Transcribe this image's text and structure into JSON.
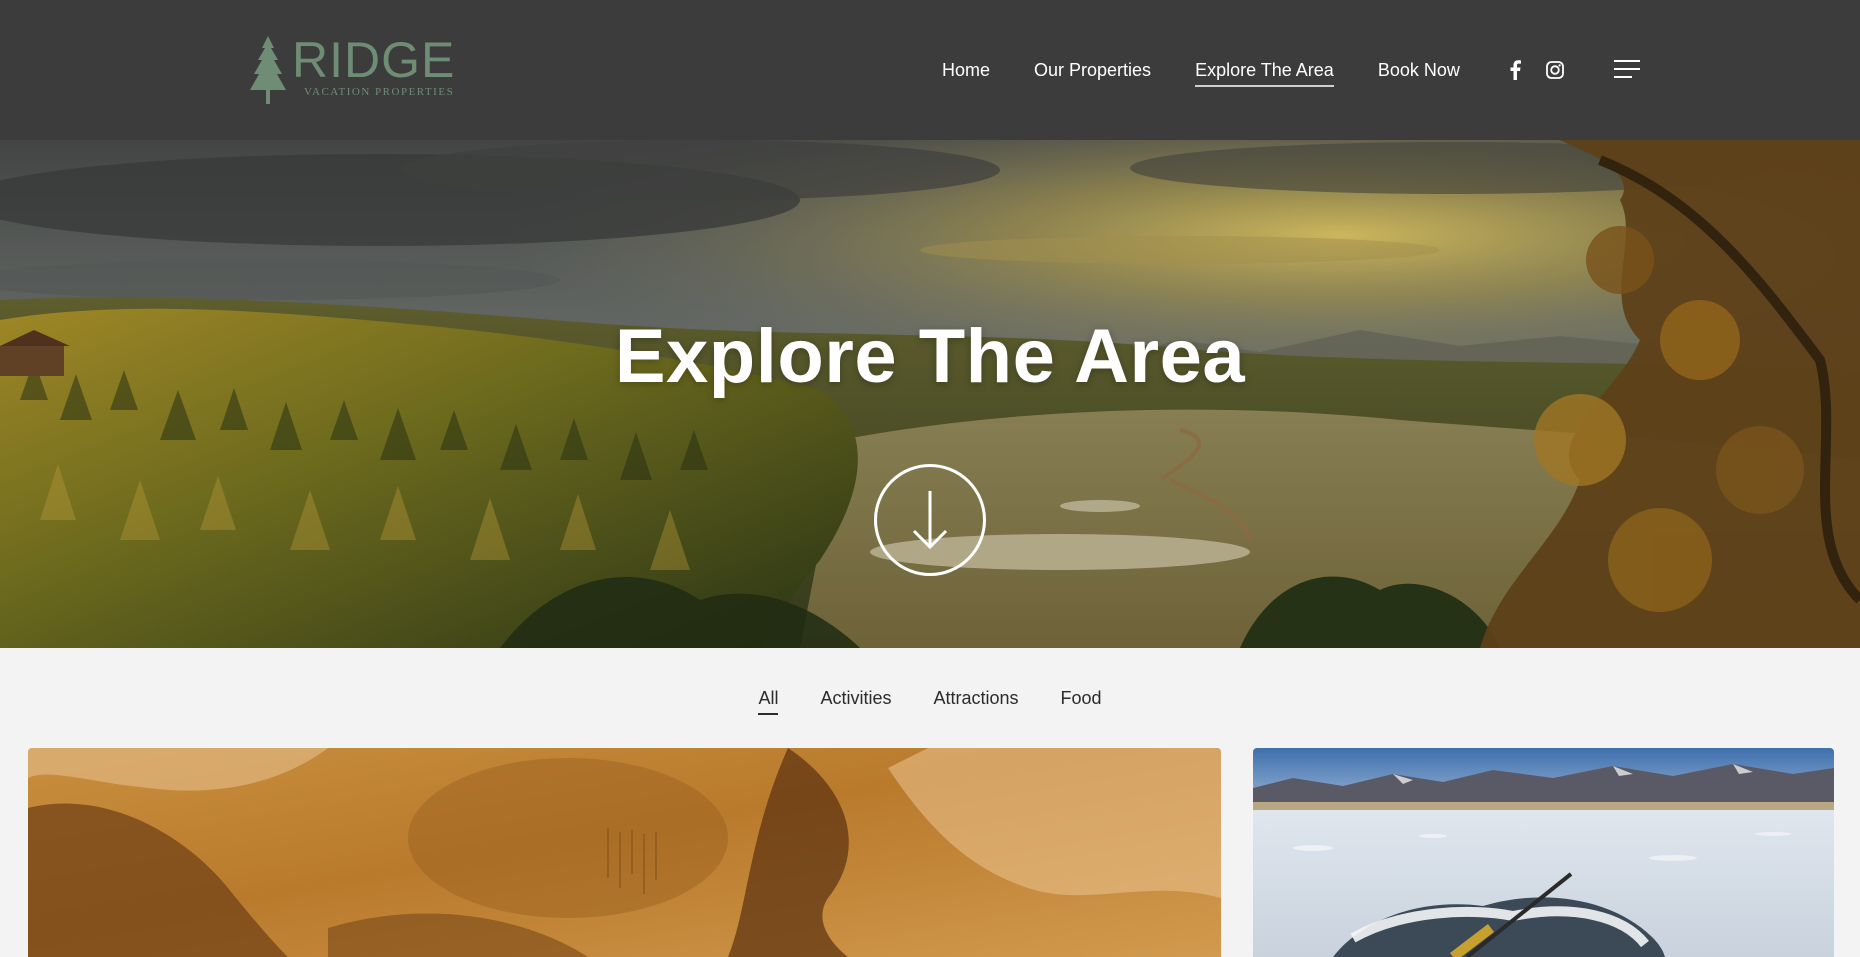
{
  "brand": {
    "name": "RIDGE",
    "tagline": "VACATION PROPERTIES",
    "color": "#6f8d75"
  },
  "header": {
    "background": "#3c3c3c",
    "nav": [
      {
        "label": "Home",
        "active": false
      },
      {
        "label": "Our Properties",
        "active": false
      },
      {
        "label": "Explore The Area",
        "active": true
      },
      {
        "label": "Book Now",
        "active": false
      }
    ],
    "social": [
      {
        "icon": "facebook-icon"
      },
      {
        "icon": "instagram-icon"
      }
    ],
    "menu_icon": "hamburger-menu-icon"
  },
  "hero": {
    "title": "Explore The Area",
    "scroll_icon": "arrow-down-circle-icon"
  },
  "filters": {
    "items": [
      {
        "label": "All",
        "active": true
      },
      {
        "label": "Activities",
        "active": false
      },
      {
        "label": "Attractions",
        "active": false
      },
      {
        "label": "Food",
        "active": false
      }
    ]
  },
  "cards": [
    {
      "image": "cave-interior"
    },
    {
      "image": "ice-fishing-lake"
    }
  ]
}
